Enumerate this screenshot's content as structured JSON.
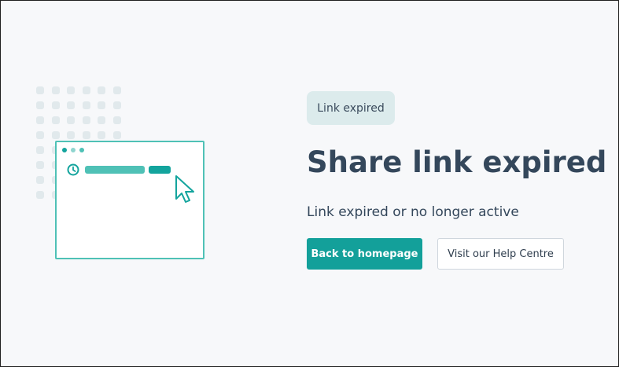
{
  "badge": {
    "label": "Link expired"
  },
  "heading": {
    "title": "Share link expired",
    "subtitle": "Link expired or no longer active"
  },
  "actions": {
    "primary_label": "Back to homepage",
    "secondary_label": "Visit our Help Centre"
  },
  "illustration": {
    "icons": [
      "clock-icon",
      "cursor-arrow-icon"
    ],
    "window_dot_colors": [
      "#13a49d",
      "#8fd5cf",
      "#4fc1b6"
    ]
  },
  "colors": {
    "accent": "#13a09a",
    "accent_light": "#4fc1b6",
    "text": "#34475b",
    "badge_bg": "#dcebec",
    "background": "#f7f8fa"
  }
}
